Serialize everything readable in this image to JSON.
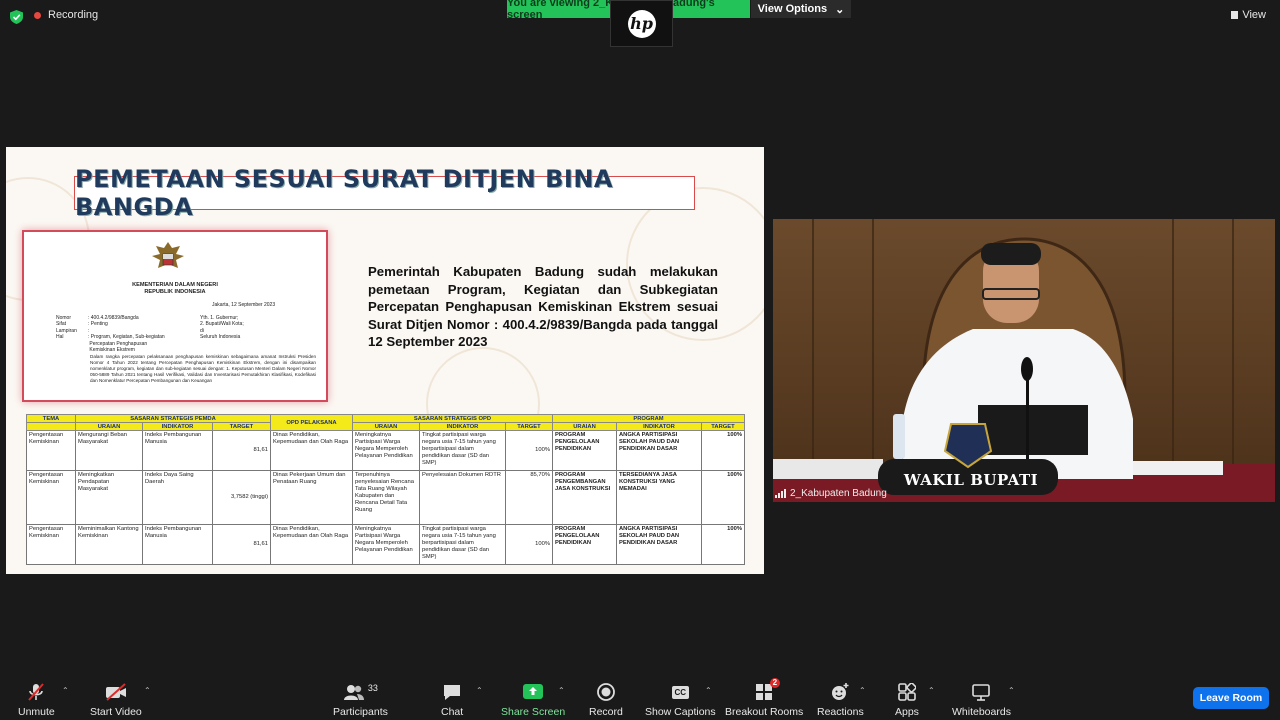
{
  "top": {
    "recording": "Recording",
    "viewing_banner": "You are viewing 2_Kabupaten Badung's screen",
    "view_options": "View Options",
    "view": "View",
    "hp_logo": "hp"
  },
  "slide": {
    "title": "PEMETAAN SESUAI SURAT DITJEN BINA BANGDA",
    "paragraph": "Pemerintah Kabupaten Badung sudah melakukan pemetaan Program, Kegiatan dan Subkegiatan Percepatan Penghapusan Kemiskinan Ekstrem sesuai Surat Ditjen Nomor : 400.4.2/9839/Bangda pada tanggal 12 September 2023",
    "document": {
      "heading_1": "KEMENTERIAN DALAM NEGERI",
      "heading_2": "REPUBLIK INDONESIA",
      "date": "Jakarta, 12 September 2023",
      "meta": [
        {
          "k": "Nomor",
          "v": ": 400.4.2/9839/Bangda"
        },
        {
          "k": "Sifat",
          "v": ": Penting"
        },
        {
          "k": "Lampiran",
          "v": ":"
        },
        {
          "k": "Hal",
          "v": ": Program, Kegiatan, Sub-kegiatan"
        },
        {
          "k": "",
          "v": "  Percepatan Penghapusan"
        },
        {
          "k": "",
          "v": "  Kemiskinan Ekstrem"
        }
      ],
      "recipients": [
        "Yth. 1. Gubernur;",
        "2. Bupati/Wali Kota;",
        "di",
        "Seluruh Indonesia"
      ],
      "body": "Dalam rangka percepatan pelaksanaan penghapusan kemiskinan sebagaimana amanat Instruksi Presiden Nomor 4 Tahun 2022 tentang Percepatan Penghapusan Kemiskinan Ekstrem, dengan ini disampaikan nomenklatur program, kegiatan dan sub-kegiatan sesuai dengan: 1. Keputusan Menteri Dalam Negeri Nomor 050-5889 Tahun 2021 tentang Hasil Verifikasi, Validasi dan Inventarisasi Pemutakhiran Klasifikasi, Kodefikasi dan Nomenklatur Percepatan Pembangunan dan Keuangan"
    },
    "table": {
      "group_headers": {
        "tema": "TEMA",
        "pemda": "SASARAN STRATEGIS PEMDA",
        "opd_pelaksana": "OPD PELAKSANA",
        "opd": "SASARAN STRATEGIS OPD",
        "program": "PROGRAM"
      },
      "sub_headers": [
        "URAIAN",
        "INDIKATOR",
        "TARGET",
        "URAIAN",
        "INDIKATOR",
        "TARGET",
        "URAIAN",
        "INDIKATOR",
        "TARGET"
      ],
      "rows": [
        {
          "tema": "Pengentasan Kemiskinan",
          "pemda_uraian": "Mengurangi Beban Masyarakat",
          "pemda_indikator": "Indeks Pembangunan Manusia",
          "pemda_target": "81,61",
          "opd_pelaksana": "Dinas Pendidikan, Kepemudaan dan Olah Raga",
          "opd_uraian": "Meningkatnya Partisipasi Warga Negara Memperoleh Pelayanan Pendidikan",
          "opd_indikator": "Tingkat partisipasi warga negara usia 7-15 tahun yang berpartisipasi dalam pendidikan dasar (SD dan SMP)",
          "opd_target": "100%",
          "prog_uraian": "PROGRAM PENGELOLAAN PENDIDIKAN",
          "prog_indikator": "ANGKA PARTISIPASI SEKOLAH PAUD DAN PENDIDIKAN DASAR",
          "prog_target": "100%"
        },
        {
          "tema": "Pengentasan Kemiskinan",
          "pemda_uraian": "Meningkatkan Pendapatan Masyarakat",
          "pemda_indikator": "Indeks Daya Saing Daerah",
          "pemda_target": "3,7582 (tinggi)",
          "opd_pelaksana": "Dinas Pekerjaan Umum dan Penataan Ruang",
          "opd_uraian": "Terpenuhinya penyelesaian Rencana Tata Ruang Wilayah Kabupaten dan Rencana Detail Tata Ruang",
          "opd_indikator": "Penyelesaian Dokumen RDTR",
          "opd_target": "85,70%",
          "prog_uraian": "PROGRAM PENGEMBANGAN JASA KONSTRUKSI",
          "prog_indikator": "TERSEDIANYA JASA KONSTRUKSI YANG MEMADAI",
          "prog_target": "100%"
        },
        {
          "tema": "Pengentasan Kemiskinan",
          "pemda_uraian": "Meminimalkan Kantong Kemiskinan",
          "pemda_indikator": "Indeks Pembangunan Manusia",
          "pemda_target": "81,61",
          "opd_pelaksana": "Dinas Pendidikan, Kepemudaan dan Olah Raga",
          "opd_uraian": "Meningkatnya Partisipasi Warga Negara Memperoleh Pelayanan Pendidikan",
          "opd_indikator": "Tingkat partisipasi warga negara usia 7-15 tahun yang berpartisipasi dalam pendidikan dasar (SD dan SMP)",
          "opd_target": "100%",
          "prog_uraian": "PROGRAM PENGELOLAAN PENDIDIKAN",
          "prog_indikator": "ANGKA PARTISIPASI SEKOLAH PAUD DAN PENDIDIKAN DASAR",
          "prog_target": "100%"
        }
      ]
    }
  },
  "camera": {
    "participant_name": "2_Kabupaten Badung",
    "nameplate": "WAKIL BUPATI"
  },
  "toolbar": {
    "unmute": "Unmute",
    "start_video": "Start Video",
    "participants": "Participants",
    "participants_count": "33",
    "chat": "Chat",
    "share_screen": "Share Screen",
    "record": "Record",
    "show_captions": "Show Captions",
    "captions_icon_text": "CC",
    "breakout_rooms": "Breakout Rooms",
    "breakout_badge": "2",
    "reactions": "Reactions",
    "apps": "Apps",
    "whiteboards": "Whiteboards",
    "leave_room": "Leave Room"
  },
  "colors": {
    "share_green": "#24c35a",
    "leave_blue": "#0e72ed",
    "recording_red": "#e5483f",
    "table_header_yellow": "#f4ea1a"
  }
}
